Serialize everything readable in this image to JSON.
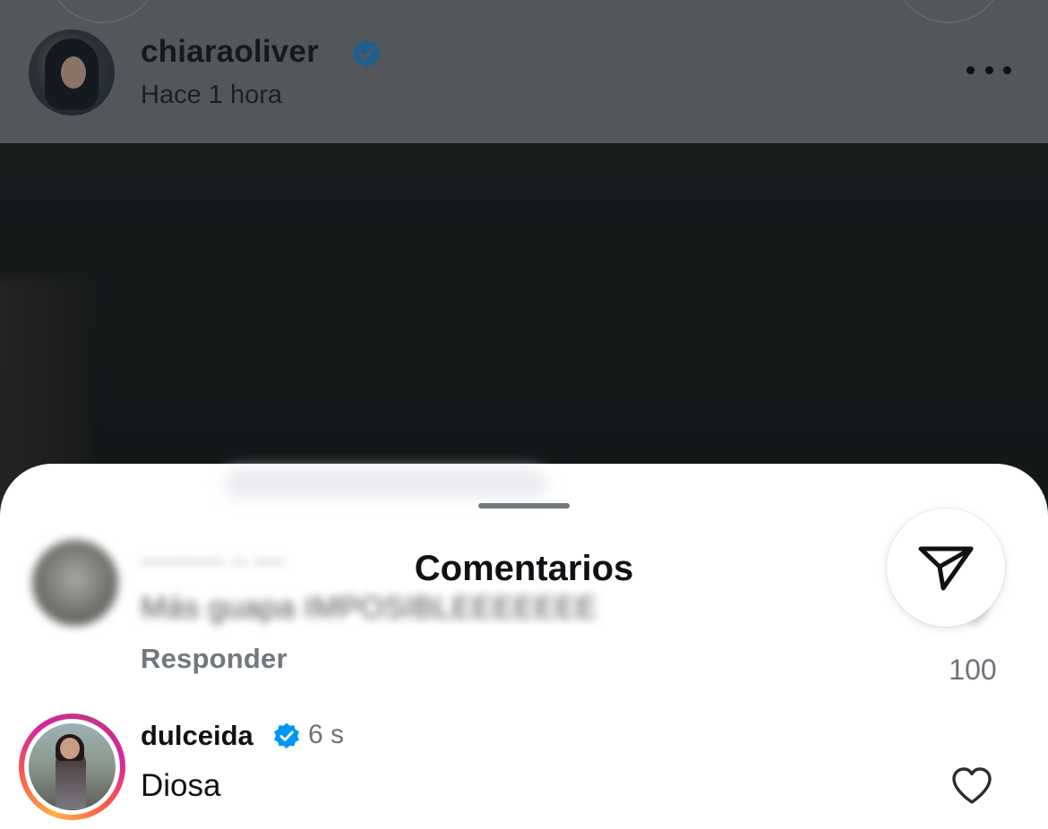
{
  "post": {
    "author": "chiaraoliver",
    "time": "Hace 1 hora",
    "author_verified": true,
    "more_icon": "more-horizontal-icon"
  },
  "comments_sheet": {
    "title": "Comentarios",
    "share_icon": "send-icon",
    "comments": [
      {
        "username": "",
        "text": "Más guapa IMPOSIBLEEEEEEE",
        "reply_label": "Responder",
        "like_count": "100",
        "blurred": true
      },
      {
        "username": "dulceida",
        "verified": true,
        "time": "6 s",
        "text": "Diosa",
        "has_story": true,
        "like_icon": "heart-outline-icon"
      }
    ]
  },
  "colors": {
    "verified_blue": "#0095f6",
    "story_ring": [
      "#fcb045",
      "#fd5949",
      "#d6249f"
    ]
  }
}
